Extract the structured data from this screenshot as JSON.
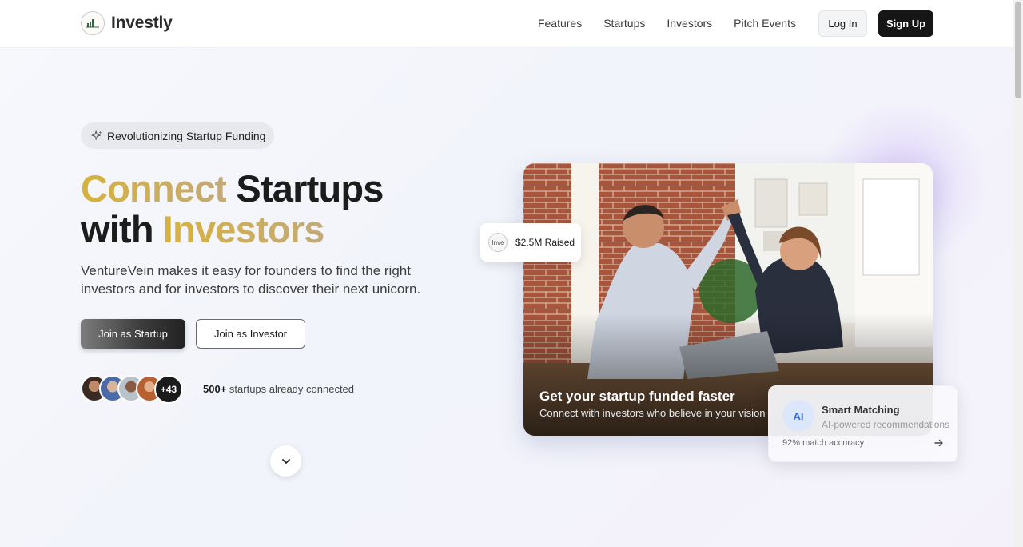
{
  "nav": {
    "brand": "Investly",
    "logo_text": "Investly",
    "links": [
      "Features",
      "Startups",
      "Investors",
      "Pitch Events"
    ],
    "login": "Log In",
    "signup": "Sign Up"
  },
  "hero": {
    "badge": "Revolutionizing Startup Funding",
    "headline_word1": "Connect",
    "headline_word2": "Startups",
    "headline_word3": "with",
    "headline_word4": "Investors",
    "subtext": "VentureVein makes it easy for founders to find the right investors and for investors to discover their next unicorn.",
    "cta_startup": "Join as Startup",
    "cta_investor": "Join as Investor",
    "avatars_more": "+43",
    "connected_count": "500+",
    "connected_text": "startups already connected"
  },
  "visual": {
    "photo_title": "Get your startup funded faster",
    "photo_subtitle": "Connect with investors who believe in your vision",
    "raised_img_alt": "Inve",
    "raised_label": "$2.5M Raised",
    "smart_badge": "AI",
    "smart_title": "Smart Matching",
    "smart_subtitle": "AI-powered recommendations",
    "smart_accuracy": "92% match accuracy"
  },
  "colors": {
    "accent_gold": "#d6b23c",
    "dark": "#161616",
    "ai_blue": "#3b6bd6"
  }
}
